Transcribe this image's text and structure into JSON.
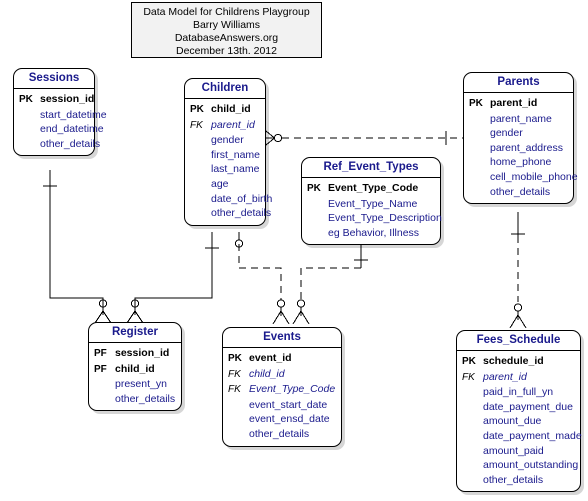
{
  "title_block": {
    "lines": [
      "Data Model for Childrens Playgroup",
      "Barry Williams",
      "DatabaseAnswers.org",
      "December 13th. 2012"
    ]
  },
  "colors": {
    "background": "#ffffff",
    "entity_fill": "#ffffff",
    "entity_border": "#000000",
    "entity_title_text": "#1a1a8c",
    "attribute_text": "#1a1a8c",
    "key_marker_text": "#000000",
    "title_block_fill": "#f2f2f2",
    "connector": "#000000"
  },
  "entities": [
    {
      "id": "sessions",
      "name": "Sessions",
      "attributes": [
        {
          "key": "PK",
          "name": "session_id",
          "kind": "pk"
        },
        {
          "key": "",
          "name": "start_datetime",
          "kind": "plain"
        },
        {
          "key": "",
          "name": "end_datetime",
          "kind": "plain"
        },
        {
          "key": "",
          "name": "other_details",
          "kind": "plain"
        }
      ]
    },
    {
      "id": "children",
      "name": "Children",
      "attributes": [
        {
          "key": "PK",
          "name": "child_id",
          "kind": "pk"
        },
        {
          "key": "FK",
          "name": "parent_id",
          "kind": "fk"
        },
        {
          "key": "",
          "name": "gender",
          "kind": "plain"
        },
        {
          "key": "",
          "name": "first_name",
          "kind": "plain"
        },
        {
          "key": "",
          "name": "last_name",
          "kind": "plain"
        },
        {
          "key": "",
          "name": "age",
          "kind": "plain"
        },
        {
          "key": "",
          "name": "date_of_birth",
          "kind": "plain"
        },
        {
          "key": "",
          "name": "other_details",
          "kind": "plain"
        }
      ]
    },
    {
      "id": "parents",
      "name": "Parents",
      "attributes": [
        {
          "key": "PK",
          "name": "parent_id",
          "kind": "pk"
        },
        {
          "key": "",
          "name": "parent_name",
          "kind": "plain"
        },
        {
          "key": "",
          "name": "gender",
          "kind": "plain"
        },
        {
          "key": "",
          "name": "parent_address",
          "kind": "plain"
        },
        {
          "key": "",
          "name": "home_phone",
          "kind": "plain"
        },
        {
          "key": "",
          "name": "cell_mobile_phone",
          "kind": "plain"
        },
        {
          "key": "",
          "name": "other_details",
          "kind": "plain"
        }
      ]
    },
    {
      "id": "ref_event_types",
      "name": "Ref_Event_Types",
      "attributes": [
        {
          "key": "PK",
          "name": "Event_Type_Code",
          "kind": "pk"
        },
        {
          "key": "",
          "name": "Event_Type_Name",
          "kind": "plain"
        },
        {
          "key": "",
          "name": "Event_Type_Description",
          "kind": "plain"
        },
        {
          "key": "",
          "name": "eg Behavior, Illness",
          "kind": "plain"
        }
      ]
    },
    {
      "id": "register",
      "name": "Register",
      "attributes": [
        {
          "key": "PF",
          "name": "session_id",
          "kind": "pf"
        },
        {
          "key": "PF",
          "name": "child_id",
          "kind": "pf"
        },
        {
          "key": "",
          "name": "present_yn",
          "kind": "plain"
        },
        {
          "key": "",
          "name": "other_details",
          "kind": "plain"
        }
      ]
    },
    {
      "id": "events",
      "name": "Events",
      "attributes": [
        {
          "key": "PK",
          "name": "event_id",
          "kind": "pk"
        },
        {
          "key": "FK",
          "name": "child_id",
          "kind": "fk"
        },
        {
          "key": "FK",
          "name": "Event_Type_Code",
          "kind": "fk"
        },
        {
          "key": "",
          "name": "event_start_date",
          "kind": "plain"
        },
        {
          "key": "",
          "name": "event_ensd_date",
          "kind": "plain"
        },
        {
          "key": "",
          "name": "other_details",
          "kind": "plain"
        }
      ]
    },
    {
      "id": "fees_schedule",
      "name": "Fees_Schedule",
      "attributes": [
        {
          "key": "PK",
          "name": "schedule_id",
          "kind": "pk"
        },
        {
          "key": "FK",
          "name": "parent_id",
          "kind": "fk"
        },
        {
          "key": "",
          "name": "paid_in_full_yn",
          "kind": "plain"
        },
        {
          "key": "",
          "name": "date_payment_due",
          "kind": "plain"
        },
        {
          "key": "",
          "name": "amount_due",
          "kind": "plain"
        },
        {
          "key": "",
          "name": "date_payment_made",
          "kind": "plain"
        },
        {
          "key": "",
          "name": "amount_paid",
          "kind": "plain"
        },
        {
          "key": "",
          "name": "amount_outstanding",
          "kind": "plain"
        },
        {
          "key": "",
          "name": "other_details",
          "kind": "plain"
        }
      ]
    }
  ],
  "relationships": [
    {
      "id": "children-parents",
      "from": "children",
      "to": "parents",
      "style": "dashed",
      "from_end": "zero-or-many",
      "to_end": "one"
    },
    {
      "id": "sessions-register",
      "from": "sessions",
      "to": "register",
      "style": "solid",
      "from_end": "one",
      "to_end": "zero-or-many"
    },
    {
      "id": "children-register",
      "from": "children",
      "to": "register",
      "style": "solid",
      "from_end": "one",
      "to_end": "zero-or-many"
    },
    {
      "id": "children-events",
      "from": "children",
      "to": "events",
      "style": "dashed",
      "from_end": "zero-or-many",
      "to_end": "zero-or-many"
    },
    {
      "id": "refeventtypes-events",
      "from": "ref_event_types",
      "to": "events",
      "style": "dashed",
      "from_end": "one",
      "to_end": "zero-or-many"
    },
    {
      "id": "parents-feesschedule",
      "from": "parents",
      "to": "fees_schedule",
      "style": "dashed",
      "from_end": "one",
      "to_end": "zero-or-many"
    }
  ]
}
